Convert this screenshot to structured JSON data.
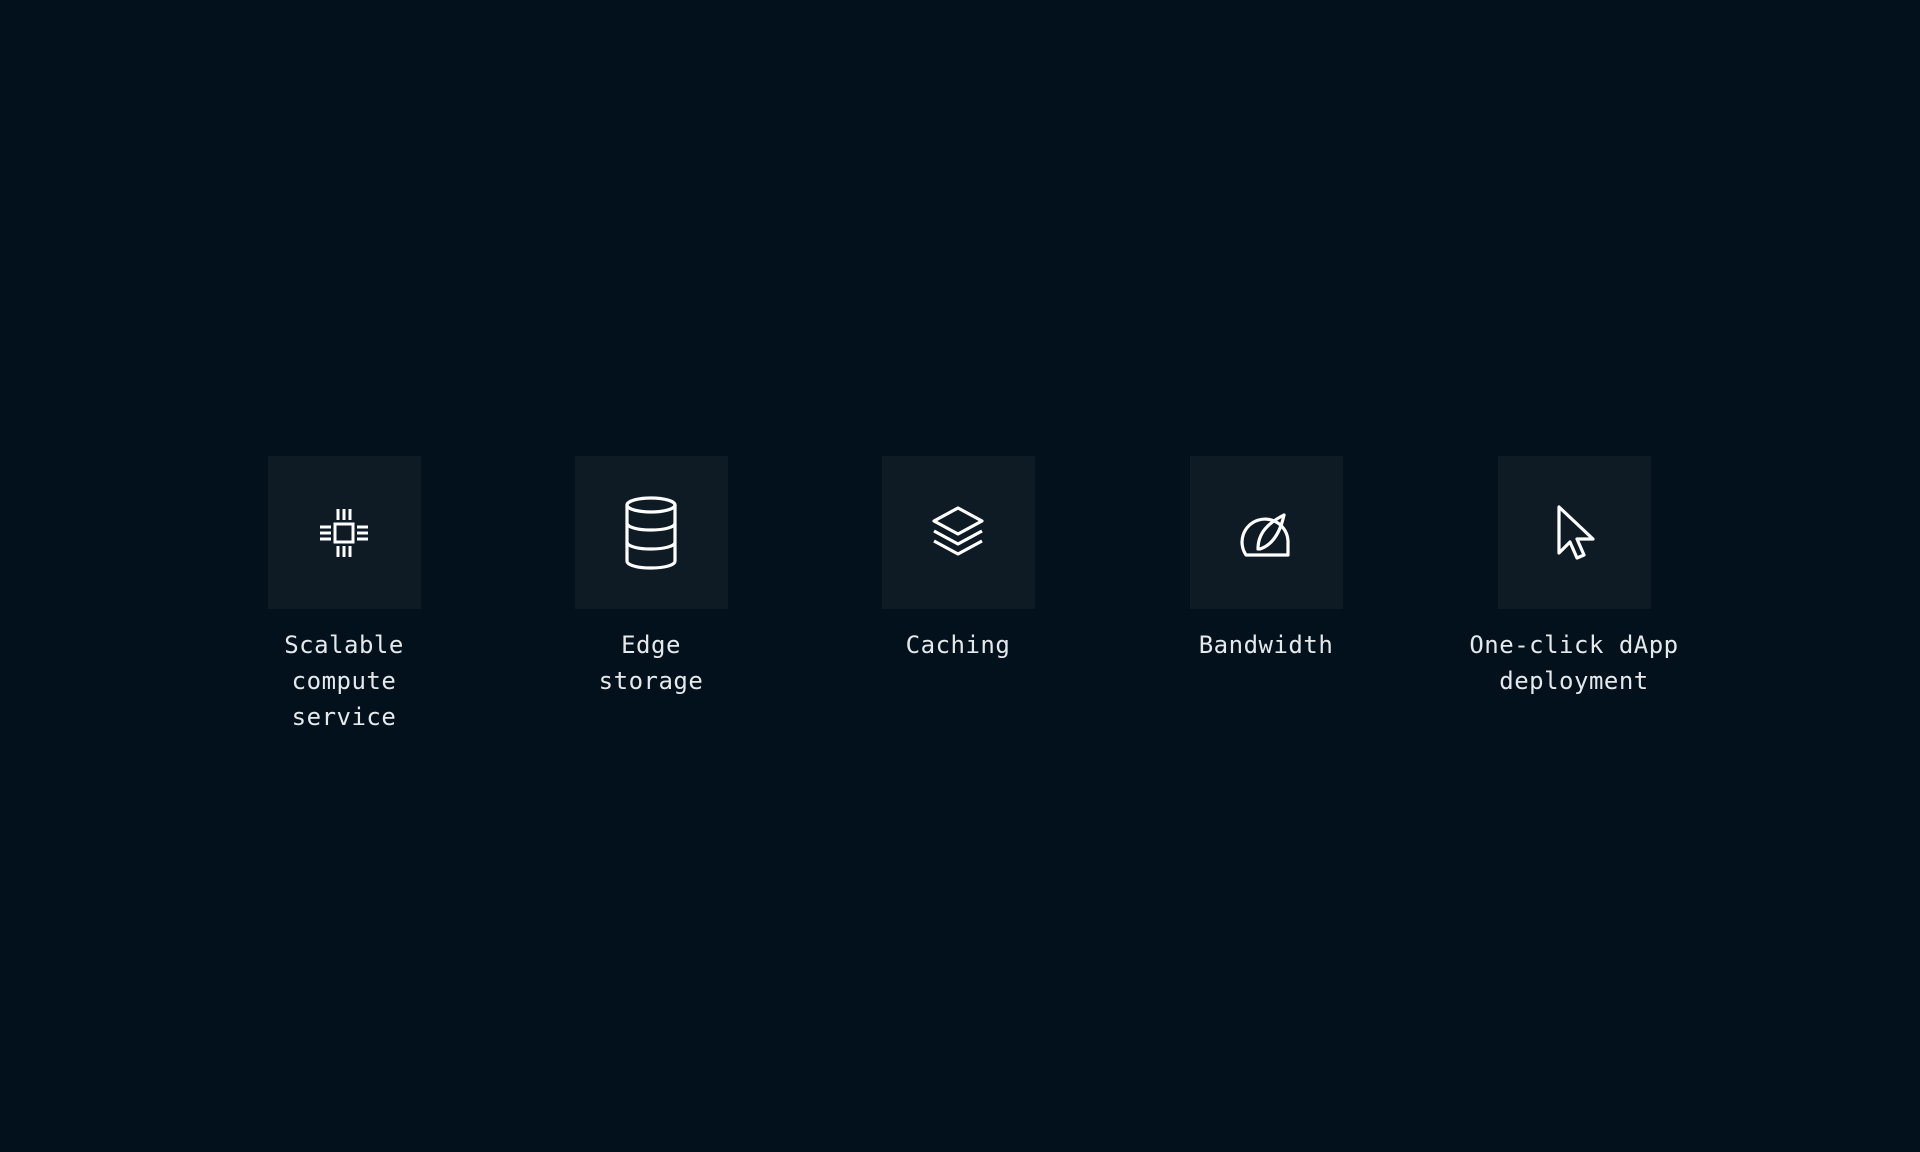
{
  "theme": {
    "background": "#02111c",
    "tile_background": "#0e1b25",
    "icon_color": "#ffffff",
    "text_color": "#e6e9ec"
  },
  "features": [
    {
      "icon": "cpu-chip-icon",
      "label": "Scalable compute service"
    },
    {
      "icon": "database-icon",
      "label": "Edge storage"
    },
    {
      "icon": "layers-icon",
      "label": "Caching"
    },
    {
      "icon": "speedometer-icon",
      "label": "Bandwidth"
    },
    {
      "icon": "cursor-pointer-icon",
      "label": "One-click dApp deployment"
    }
  ]
}
